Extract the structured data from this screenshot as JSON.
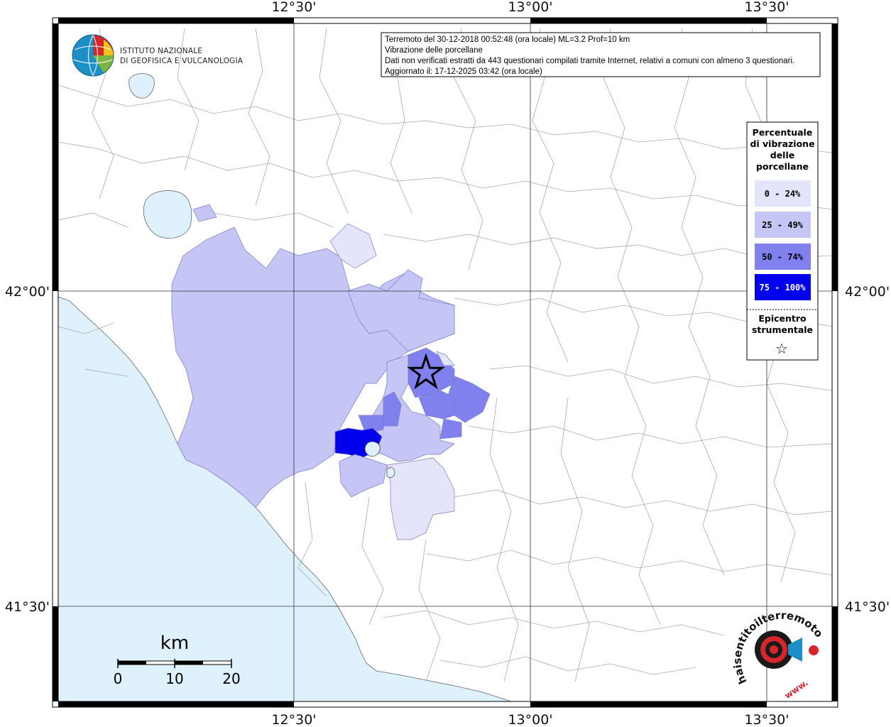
{
  "info": {
    "lines": [
      "Terremoto del 30-12-2018 00:52:48 (ora locale) ML=3.2 Prof=10 km",
      "Vibrazione delle porcellane",
      "Dati non verificati estratti da 443 questionari compilati tramite Internet, relativi a comuni con almeno 3 questionari.",
      "Aggiornato il: 17-12-2025 03:42 (ora locale)"
    ]
  },
  "institute": {
    "line1": "ISTITUTO NAZIONALE",
    "line2": "DI GEOFISICA E VULCANOLOGIA"
  },
  "axes": {
    "top": [
      "12°30'",
      "13°00'",
      "13°30'"
    ],
    "bottom": [
      "12°30'",
      "13°00'",
      "13°30'"
    ],
    "left": [
      "42°00'",
      "41°30'"
    ],
    "right": [
      "42°00'",
      "41°30'"
    ]
  },
  "legend": {
    "title_lines": [
      "Percentuale",
      "di vibrazione",
      "delle",
      "porcellane"
    ],
    "classes": [
      {
        "label": "0 - 24%",
        "color": "#e4e4fb",
        "text_color": "#000000"
      },
      {
        "label": "25 - 49%",
        "color": "#c5c5f6",
        "text_color": "#000000"
      },
      {
        "label": "50 - 74%",
        "color": "#8080ee",
        "text_color": "#000000"
      },
      {
        "label": "75 - 100%",
        "color": "#0000ee",
        "text_color": "#ffffff"
      }
    ],
    "epicenter_lines": [
      "Epicentro",
      "strumentale"
    ],
    "epicenter_symbol": "☆"
  },
  "scale": {
    "unit": "km",
    "ticks": [
      "0",
      "10",
      "20"
    ]
  },
  "brand": {
    "text": "haisentitoilterremoto.it",
    "suffix": "www."
  },
  "colors": {
    "sea": "#dff1fc",
    "lake": "#dff1fc",
    "land": "#ffffff",
    "border": "#a8a8a8"
  }
}
